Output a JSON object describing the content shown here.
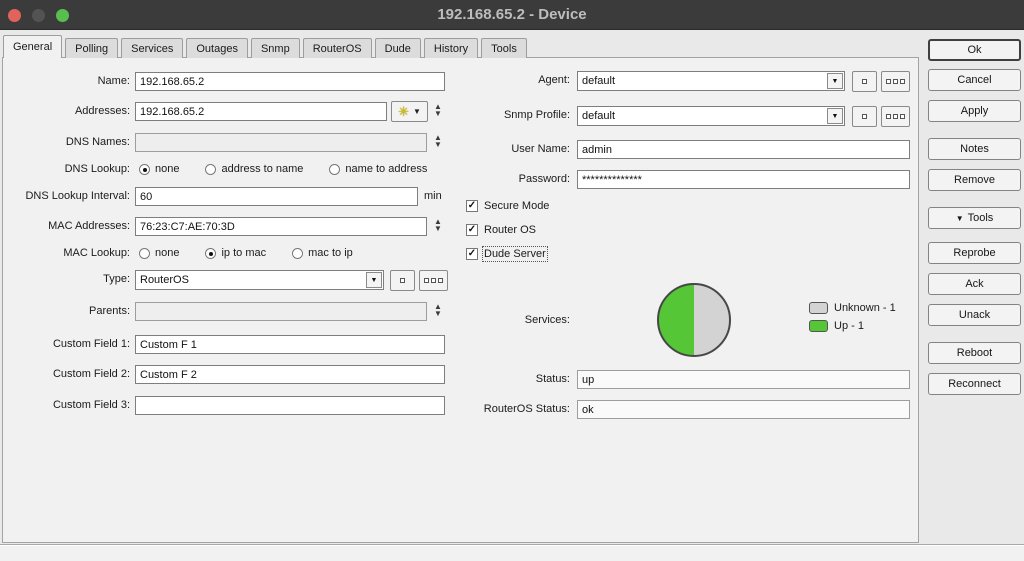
{
  "window": {
    "title": "192.168.65.2 - Device"
  },
  "colors": {
    "titlebar": "#3b3b3b",
    "traffic_red": "#e0635c",
    "traffic_gray": "#535353",
    "traffic_green": "#58bf4e"
  },
  "icons": {
    "dropdown_arrow": "▼",
    "spinner_up": "▲",
    "spinner_down": "▼",
    "gear": "✳",
    "check": "✓",
    "tools_arrow": "▼"
  },
  "tabs": [
    {
      "label": "General",
      "active": true
    },
    {
      "label": "Polling",
      "active": false
    },
    {
      "label": "Services",
      "active": false
    },
    {
      "label": "Outages",
      "active": false
    },
    {
      "label": "Snmp",
      "active": false
    },
    {
      "label": "RouterOS",
      "active": false
    },
    {
      "label": "Dude",
      "active": false
    },
    {
      "label": "History",
      "active": false
    },
    {
      "label": "Tools",
      "active": false
    }
  ],
  "fields": {
    "name": {
      "label": "Name:",
      "value": "192.168.65.2"
    },
    "addresses": {
      "label": "Addresses:",
      "value": "192.168.65.2"
    },
    "dns_names": {
      "label": "DNS Names:",
      "value": ""
    },
    "dns_lookup": {
      "label": "DNS Lookup:",
      "options": [
        "none",
        "address to name",
        "name to address"
      ],
      "selected": "none"
    },
    "dns_lookup_interval": {
      "label": "DNS Lookup Interval:",
      "value": "60",
      "unit": "min"
    },
    "mac_addresses": {
      "label": "MAC Addresses:",
      "value": "76:23:C7:AE:70:3D"
    },
    "mac_lookup": {
      "label": "MAC Lookup:",
      "options": [
        "none",
        "ip to mac",
        "mac to ip"
      ],
      "selected": "ip to mac"
    },
    "type": {
      "label": "Type:",
      "value": "RouterOS"
    },
    "parents": {
      "label": "Parents:",
      "value": ""
    },
    "custom_field_1": {
      "label": "Custom Field 1:",
      "value": "Custom F 1"
    },
    "custom_field_2": {
      "label": "Custom Field 2:",
      "value": "Custom F 2"
    },
    "custom_field_3": {
      "label": "Custom Field 3:",
      "value": ""
    },
    "agent": {
      "label": "Agent:",
      "value": "default"
    },
    "snmp_profile": {
      "label": "Snmp Profile:",
      "value": "default"
    },
    "user_name": {
      "label": "User Name:",
      "value": "admin"
    },
    "password": {
      "label": "Password:",
      "value": "**************"
    },
    "secure_mode": {
      "label": "Secure Mode",
      "checked": true
    },
    "router_os": {
      "label": "Router OS",
      "checked": true
    },
    "dude_server": {
      "label": "Dude Server",
      "checked": true
    },
    "services": {
      "label": "Services:"
    },
    "status": {
      "label": "Status:",
      "value": "up"
    },
    "routeros_status": {
      "label": "RouterOS Status:",
      "value": "ok"
    }
  },
  "services_chart": {
    "type": "pie",
    "segments": [
      {
        "label": "Unknown",
        "value": 1,
        "color": "#d3d3d3"
      },
      {
        "label": "Up",
        "value": 1,
        "color": "#55c636"
      }
    ],
    "legend": [
      {
        "label": "Unknown - 1",
        "color": "#d3d3d3"
      },
      {
        "label": "Up - 1",
        "color": "#55c636"
      }
    ]
  },
  "buttons": {
    "ok": "Ok",
    "cancel": "Cancel",
    "apply": "Apply",
    "notes": "Notes",
    "remove": "Remove",
    "tools": "Tools",
    "reprobe": "Reprobe",
    "ack": "Ack",
    "unack": "Unack",
    "reboot": "Reboot",
    "reconnect": "Reconnect"
  }
}
